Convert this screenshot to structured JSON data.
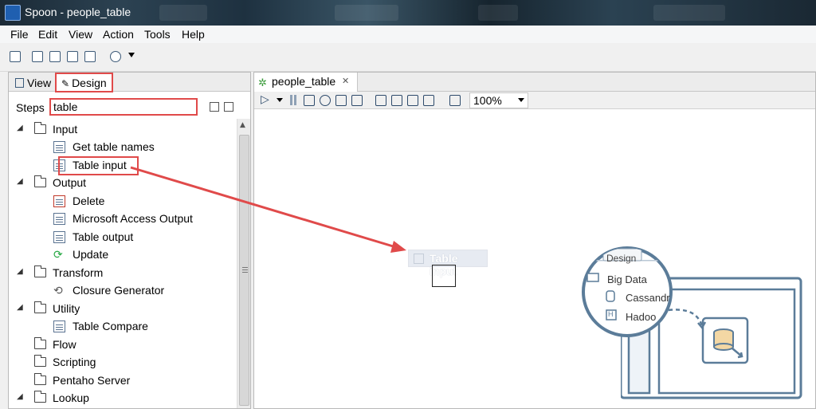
{
  "window": {
    "title": "Spoon - people_table"
  },
  "menu": [
    "File",
    "Edit",
    "View",
    "Action",
    "Tools",
    "Help"
  ],
  "left_panel": {
    "tab_view": "View",
    "tab_design": "Design",
    "steps_label": "Steps",
    "search_value": "table"
  },
  "tree": {
    "input": "Input",
    "get_table_names": "Get table names",
    "table_input": "Table input",
    "output": "Output",
    "delete": "Delete",
    "ms_access_output": "Microsoft Access Output",
    "table_output": "Table output",
    "update": "Update",
    "transform": "Transform",
    "closure_generator": "Closure Generator",
    "utility": "Utility",
    "table_compare": "Table Compare",
    "flow": "Flow",
    "scripting": "Scripting",
    "pentaho_server": "Pentaho Server",
    "lookup": "Lookup"
  },
  "editor": {
    "tab_label": "people_table",
    "zoom": "100%",
    "dragged_label": "Table input"
  },
  "help_graphic": {
    "tab": "Design",
    "folder": "Big Data",
    "item1": "Cassandr",
    "item2": "Hadoo"
  },
  "colors": {
    "highlight": "#e04a4a",
    "arrow": "#e04a4a",
    "help_stroke": "#5b7c99"
  }
}
